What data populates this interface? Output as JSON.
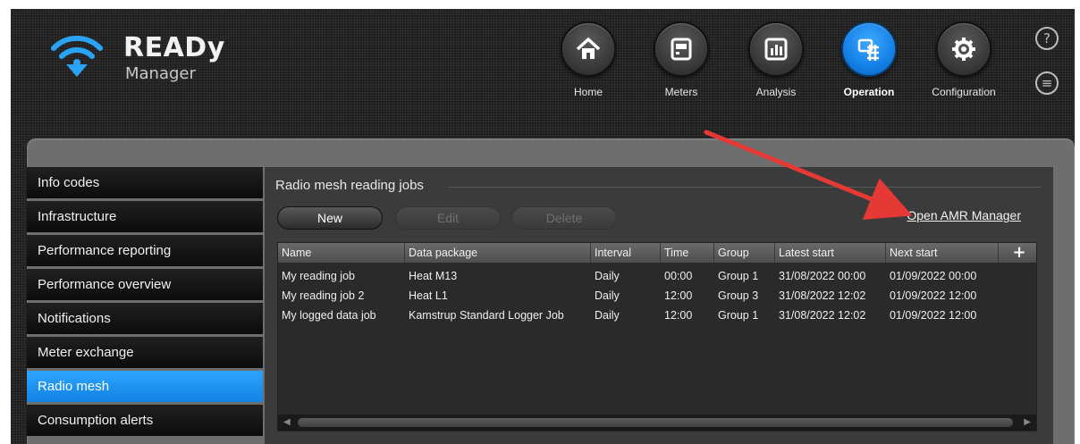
{
  "app": {
    "logo_title": "READy",
    "logo_subtitle": "Manager"
  },
  "nav": [
    {
      "label": "Home",
      "icon": "home-icon"
    },
    {
      "label": "Meters",
      "icon": "meter-icon"
    },
    {
      "label": "Analysis",
      "icon": "bar-chart-icon"
    },
    {
      "label": "Operation",
      "icon": "operation-icon",
      "active": true
    },
    {
      "label": "Configuration",
      "icon": "gear-icon"
    }
  ],
  "side_icons": {
    "help": "?",
    "menu": "≡"
  },
  "sidebar": {
    "items": [
      {
        "label": "Info codes"
      },
      {
        "label": "Infrastructure"
      },
      {
        "label": "Performance reporting"
      },
      {
        "label": "Performance overview"
      },
      {
        "label": "Notifications"
      },
      {
        "label": "Meter exchange"
      },
      {
        "label": "Radio mesh",
        "active": true
      },
      {
        "label": "Consumption alerts"
      }
    ]
  },
  "content": {
    "title": "Radio mesh reading jobs",
    "buttons": {
      "new": "New",
      "edit": "Edit",
      "delete": "Delete"
    },
    "amr_link": "Open AMR Manager",
    "table": {
      "columns": [
        "Name",
        "Data package",
        "Interval",
        "Time",
        "Group",
        "Latest start",
        "Next start"
      ],
      "add_label": "+",
      "rows": [
        [
          "My reading job",
          "Heat M13",
          "Daily",
          "00:00",
          "Group 1",
          "31/08/2022 00:00",
          "01/09/2022 00:00"
        ],
        [
          "My reading job 2",
          "Heat L1",
          "Daily",
          "12:00",
          "Group 3",
          "31/08/2022 12:02",
          "01/09/2022 12:00"
        ],
        [
          "My logged data job",
          "Kamstrup Standard Logger Job",
          "Daily",
          "12:00",
          "Group 1",
          "31/08/2022 12:02",
          "01/09/2022 12:00"
        ]
      ]
    }
  },
  "colors": {
    "accent": "#1a8fec",
    "annotation_arrow": "#e53935"
  }
}
